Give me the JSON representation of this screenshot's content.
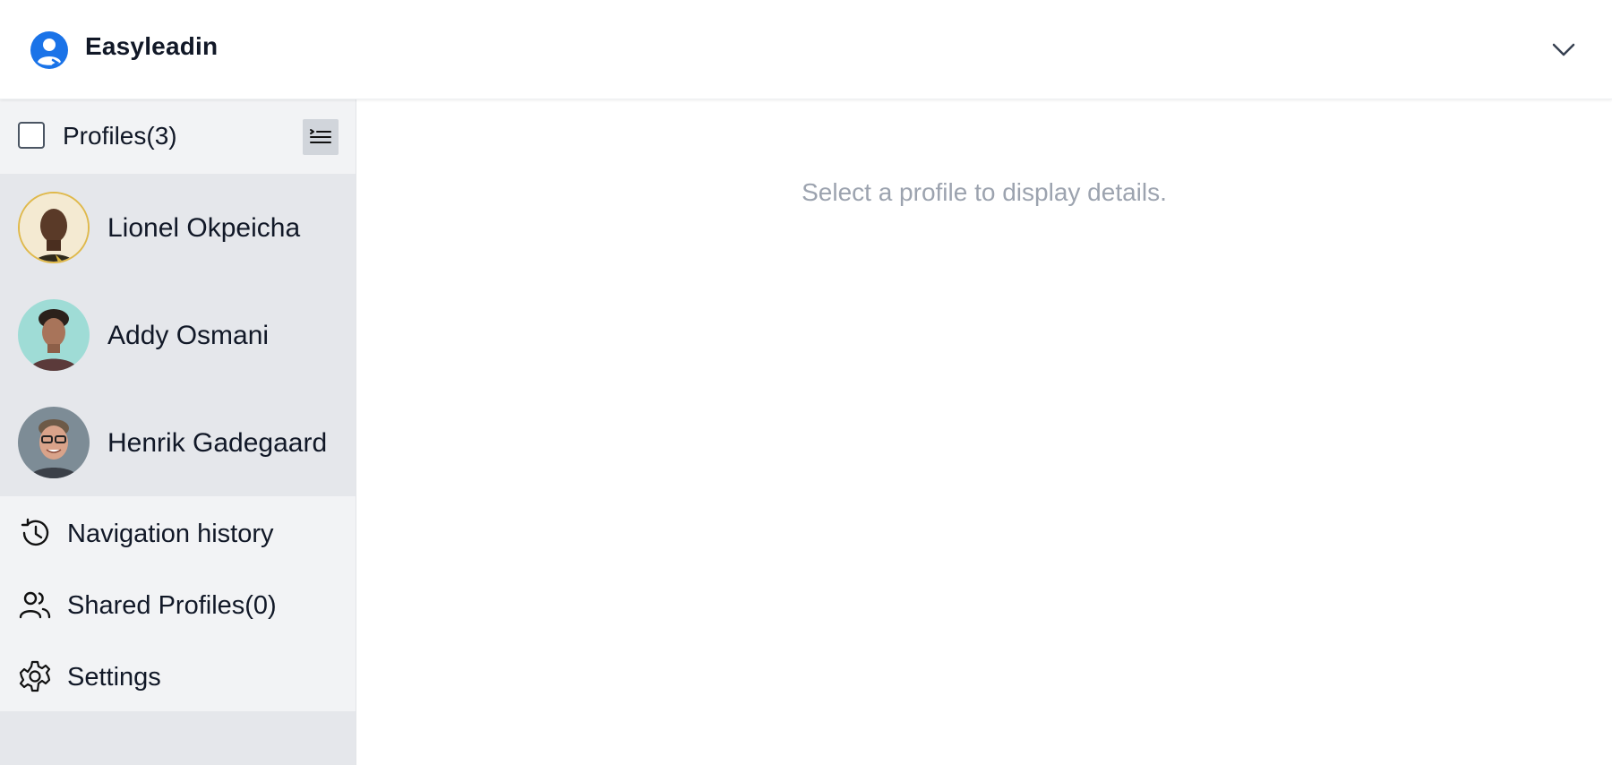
{
  "header": {
    "app_name": "Easyleadin",
    "logo_icon": "user-circle-icon",
    "menu_icon": "chevron-down-icon",
    "accent_color": "#1a73e8"
  },
  "sidebar": {
    "profiles_title": "Profiles(3)",
    "select_all_checked": false,
    "view_toggle_icon": "list-icon",
    "profiles": [
      {
        "name": "Lionel Okpeicha",
        "avatar_bg": "#f3e6c4"
      },
      {
        "name": "Addy Osmani",
        "avatar_bg": "#9fdcd6"
      },
      {
        "name": "Henrik Gadegaard",
        "avatar_bg": "#8a9aa8"
      }
    ],
    "nav": [
      {
        "label": "Navigation history",
        "icon": "history-icon"
      },
      {
        "label": "Shared Profiles(0)",
        "icon": "users-icon"
      },
      {
        "label": "Settings",
        "icon": "gear-icon"
      }
    ]
  },
  "main": {
    "empty_message": "Select a profile to display details."
  }
}
